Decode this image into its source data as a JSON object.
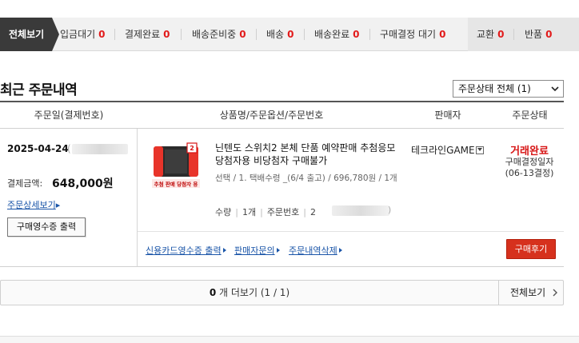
{
  "tabs": {
    "all_label": "전체보기",
    "items": [
      {
        "label": "입금대기",
        "count": "0"
      },
      {
        "label": "결제완료",
        "count": "0"
      },
      {
        "label": "배송준비중",
        "count": "0"
      },
      {
        "label": "배송",
        "count": "0"
      },
      {
        "label": "배송완료",
        "count": "0"
      },
      {
        "label": "구매결정 대기",
        "count": "0"
      },
      {
        "label": "교환",
        "count": "0"
      },
      {
        "label": "반품",
        "count": "0"
      }
    ]
  },
  "section": {
    "title": "최근 주문내역",
    "filter_value": "주문상태 전체 (1)"
  },
  "table": {
    "headers": [
      "주문일(결제번호)",
      "상품명/주문옵션/주문번호",
      "판매자",
      "주문상태"
    ]
  },
  "order": {
    "date": "2025-04-24",
    "pay_label": "결제금액:",
    "pay_amount": "648,000원",
    "detail_link": "주문상세보기",
    "receipt_button": "구매영수증 출력",
    "product_name": "닌텐도 스위치2 본체 단품 예약판매 추첨응모당첨자용 비당첨자 구매불가",
    "product_option": "선택 / 1. 택배수령 _(6/4 출고) / 696,780원 / 1개",
    "qty_label": "수량",
    "qty_value": "1개",
    "order_no_label": "주문번호",
    "order_no_prefix": "2",
    "seller": "테크라인GAME",
    "status": "거래완료",
    "status_sub_label": "구매결정일자",
    "status_sub_date": "(06-13결정)",
    "image_badge": "추첨 판매 당첨자 용",
    "actions": {
      "card_receipt": "신용카드영수증 출력",
      "seller_inquiry": "판매자문의",
      "delete_order": "주문내역삭제",
      "review_button": "구매후기"
    }
  },
  "pager": {
    "count": "0",
    "more_label": "개 더보기 (1 / 1)",
    "all_label": "전체보기"
  },
  "colors": {
    "accent_red": "#e21b1b",
    "dark_tab": "#3a3a3a",
    "link_blue": "#1a55a8",
    "review_button": "#d6311d"
  }
}
